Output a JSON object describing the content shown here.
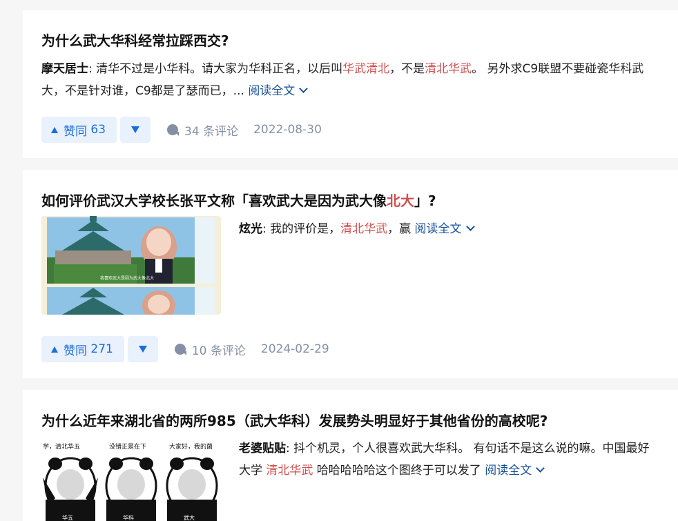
{
  "cards": [
    {
      "title": "为什么武大华科经常拉踩西交?",
      "author": "摩天居士",
      "sep": ":",
      "excerpt_a": "清华不过是小华科。请大家为华科正名，以后叫",
      "hl_1": "华武清北",
      "excerpt_b": "，不是",
      "hl_2": "清北华武",
      "excerpt_c": "。 另外求C9联盟不要碰瓷华科武大，不是针对谁，C9都是了瑟而已，... ",
      "read_more": "阅读全文",
      "upvote_label": "赞同",
      "upvote_count": "63",
      "comments": "34 条评论",
      "date": "2022-08-30"
    },
    {
      "title_a": "如何评价武汉大学校长张平文称「喜欢武大是因为武大像",
      "title_hl": "北大",
      "title_b": "」?",
      "author": "炫光",
      "sep": ":",
      "excerpt_a": "我的评价是，",
      "hl_1": "清北华武",
      "excerpt_b": "，赢 ",
      "read_more": "阅读全文",
      "upvote_label": "赞同",
      "upvote_count": "271",
      "comments": "10 条评论",
      "date": "2024-02-29",
      "thumb_caption": "我喜欢武大是因为武大像北大"
    },
    {
      "title": "为什么近年来湖北省的两所985（武大华科）发展势头明显好于其他省份的高校呢?",
      "author": "老婆贴贴",
      "sep": ":",
      "excerpt_a": "抖个机灵，个人很喜欢武大华科。 有句话不是这么说的嘛。中国最好大学 ",
      "hl_1": "清北华武",
      "excerpt_b": " 哈哈哈哈哈这个图终于可以发了 ",
      "read_more": "阅读全文",
      "meme_captions": [
        "学，清北华五",
        "没错正是在下",
        "大家好，我的菌"
      ],
      "meme_labels": [
        "华五",
        "华科",
        "武大"
      ]
    }
  ],
  "colors": {
    "highlight": "#d24f4f",
    "link": "#175199",
    "vote_bg": "#e9f1fd",
    "vote_fg": "#1a6ddc",
    "meta": "#8590a6"
  }
}
